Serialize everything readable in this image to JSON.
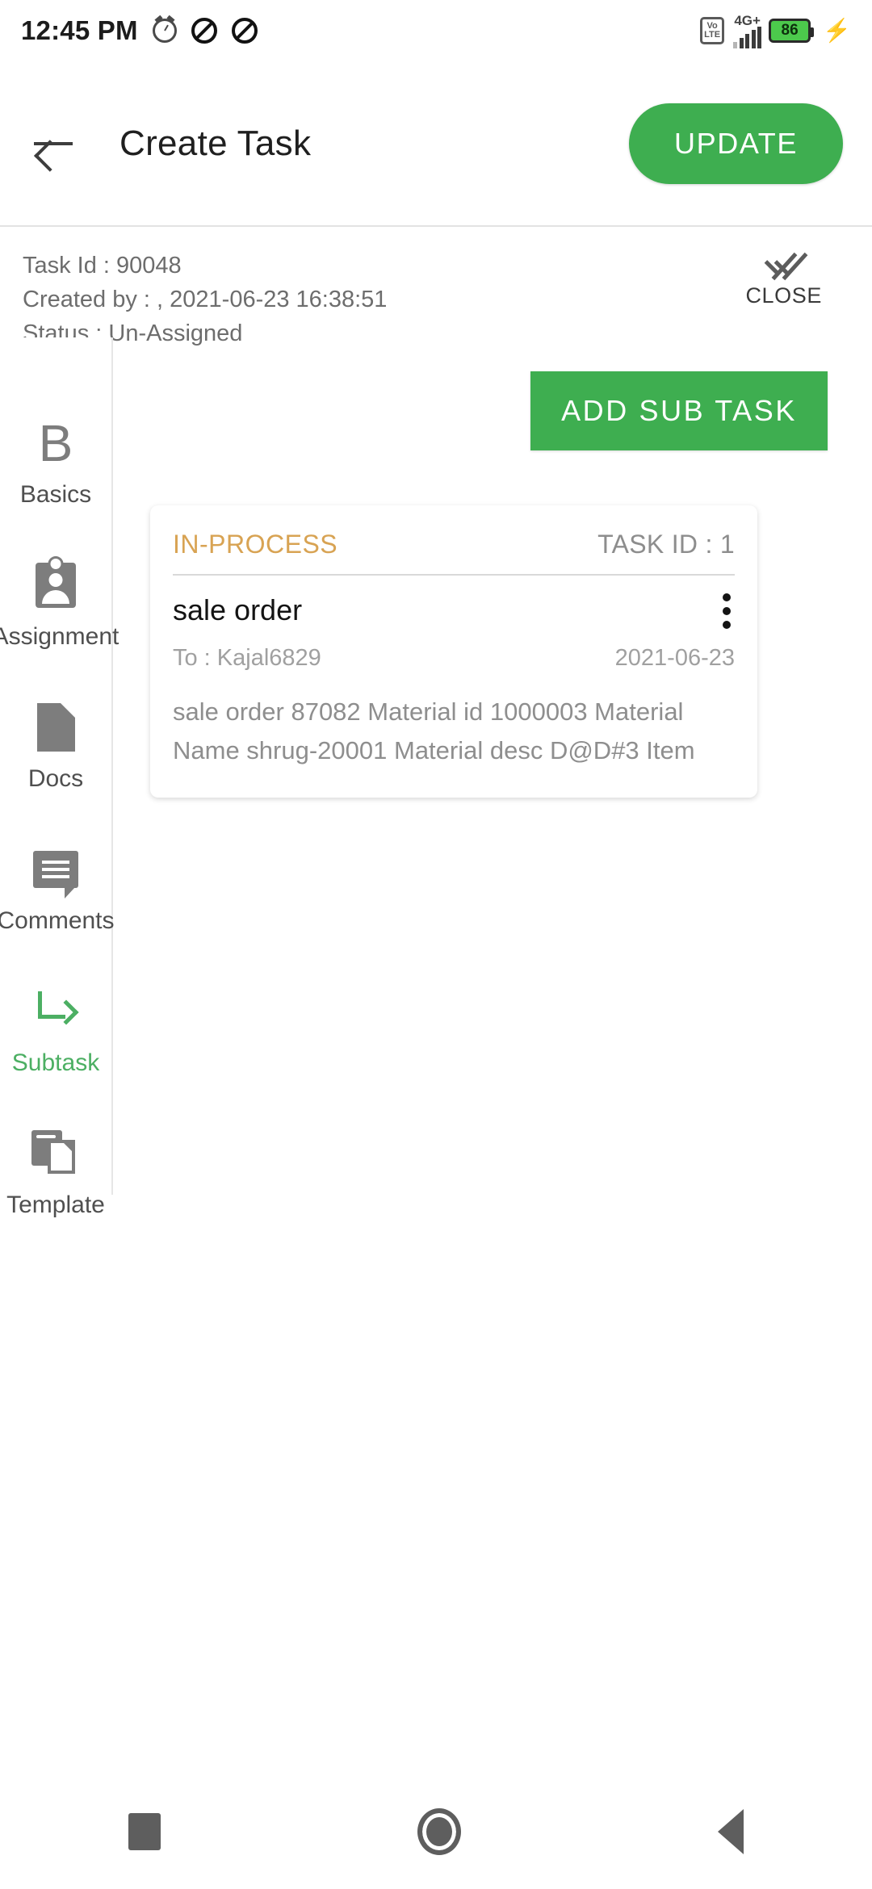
{
  "status_bar": {
    "time": "12:45 PM",
    "alarm_icon": "alarm-icon",
    "mute_icon_1": "mute-icon",
    "mute_icon_2": "mute-icon",
    "volte_line1": "Vo",
    "volte_line2": "LTE",
    "network": "4G+",
    "battery_level": "86",
    "charging_glyph": "⚡"
  },
  "appbar": {
    "back_icon": "back-arrow-icon",
    "title": "Create Task",
    "update_label": "UPDATE",
    "accent_green": "#3EAE50"
  },
  "meta": {
    "task_id": "Task Id : 90048",
    "created_by": "Created by : , 2021-06-23 16:38:51",
    "status": "Status : Un-Assigned",
    "close_label": "CLOSE",
    "close_icon": "double-check-icon"
  },
  "sidebar": {
    "items": [
      {
        "label": "Basics",
        "icon": "letter-b-icon",
        "active": false
      },
      {
        "label": "Assignment",
        "icon": "id-badge-icon",
        "active": false
      },
      {
        "label": "Docs",
        "icon": "document-icon",
        "active": false
      },
      {
        "label": "Comments",
        "icon": "comment-bubble-icon",
        "active": false
      },
      {
        "label": "Subtask",
        "icon": "subdirectory-arrow-icon",
        "active": true
      },
      {
        "label": "Template",
        "icon": "template-copy-icon",
        "active": false
      }
    ],
    "active_color": "#4CAF63",
    "inactive_color": "#4f4f4f"
  },
  "main": {
    "add_sub_task_label": "ADD SUB TASK",
    "subtasks": [
      {
        "status": "IN-PROCESS",
        "status_color": "#D8A353",
        "task_id": "TASK ID : 1",
        "title": "sale order",
        "assignee": "To : Kajal6829",
        "date": "2021-06-23",
        "description": "sale order 87082 Material id  1000003 Material Name shrug-20001 Material desc D@D#3 Item",
        "menu_icon": "kebab-menu-icon"
      }
    ]
  },
  "navbar": {
    "recents_icon": "square-recents-icon",
    "home_icon": "circle-home-icon",
    "back_icon": "triangle-back-icon"
  }
}
